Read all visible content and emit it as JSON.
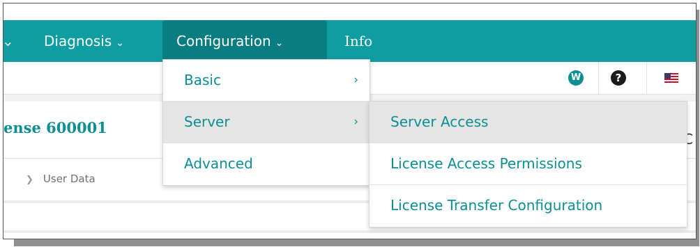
{
  "nav": {
    "left_chevron": "⌄",
    "diagnosis_label": "Diagnosis",
    "diagnosis_chevron": "⌄",
    "configuration_label": "Configuration",
    "configuration_chevron": "⌄",
    "info_label": "Info"
  },
  "toolbar": {
    "wizard_badge": "W",
    "help_badge": "?"
  },
  "content": {
    "license_title": "ense 600001",
    "edge_letter": "C",
    "user_data_label": "User Data"
  },
  "config_menu": {
    "items": [
      {
        "label": "Basic",
        "arrow": "›"
      },
      {
        "label": "Server",
        "arrow": "›"
      },
      {
        "label": "Advanced",
        "arrow": ""
      }
    ]
  },
  "server_submenu": {
    "items": [
      {
        "label": "Server Access"
      },
      {
        "label": "License Access Permissions"
      },
      {
        "label": "License Transfer Configuration"
      }
    ]
  },
  "colors": {
    "nav_bg": "#0e9da0",
    "nav_active_bg": "#097d80",
    "accent_text": "#0b8f92",
    "menu_highlight": "#e5e5e5"
  },
  "icons": [
    "chevron-down-icon",
    "wizard-icon",
    "help-icon",
    "us-flag-icon",
    "chevron-right-icon"
  ]
}
